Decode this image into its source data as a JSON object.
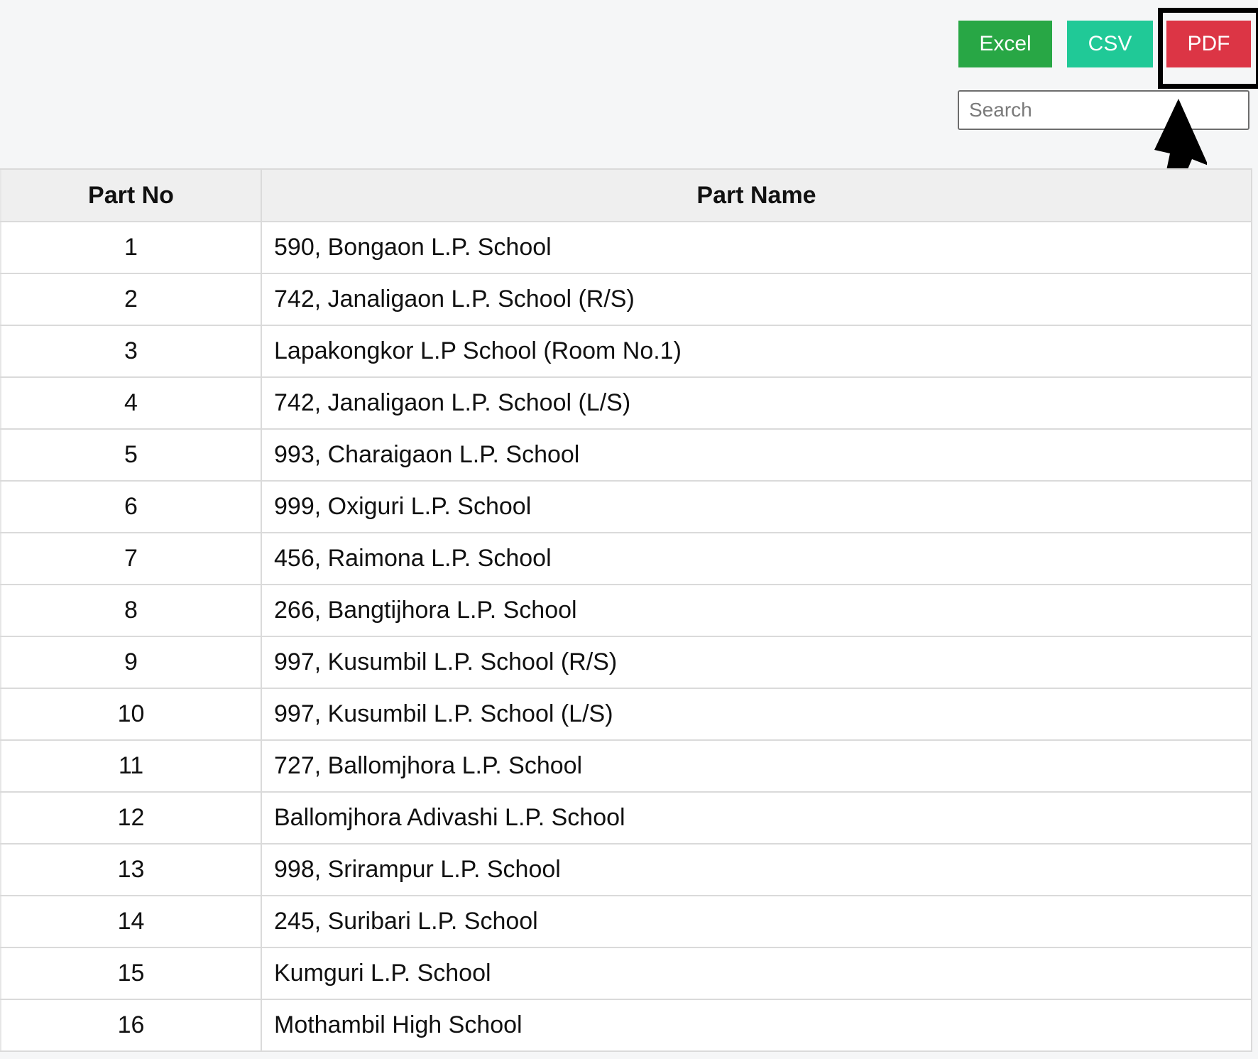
{
  "toolbar": {
    "excel_label": "Excel",
    "csv_label": "CSV",
    "pdf_label": "PDF"
  },
  "search": {
    "placeholder": "Search",
    "value": ""
  },
  "colors": {
    "excel": "#28a745",
    "csv": "#20c997",
    "pdf": "#dc3545"
  },
  "annotation": {
    "highlight_target": "pdf-button",
    "arrow_icon": "arrow-up-icon"
  },
  "table": {
    "columns": [
      "Part No",
      "Part Name"
    ],
    "rows": [
      [
        "1",
        "590, Bongaon L.P. School"
      ],
      [
        "2",
        "742, Janaligaon L.P. School (R/S)"
      ],
      [
        "3",
        "Lapakongkor L.P School (Room No.1)"
      ],
      [
        "4",
        "742, Janaligaon L.P. School (L/S)"
      ],
      [
        "5",
        "993, Charaigaon L.P. School"
      ],
      [
        "6",
        "999, Oxiguri L.P. School"
      ],
      [
        "7",
        "456, Raimona L.P. School"
      ],
      [
        "8",
        "266, Bangtijhora L.P. School"
      ],
      [
        "9",
        "997, Kusumbil L.P. School (R/S)"
      ],
      [
        "10",
        "997, Kusumbil L.P. School (L/S)"
      ],
      [
        "11",
        "727, Ballomjhora L.P. School"
      ],
      [
        "12",
        "Ballomjhora Adivashi L.P. School"
      ],
      [
        "13",
        "998, Srirampur L.P. School"
      ],
      [
        "14",
        "245, Suribari L.P. School"
      ],
      [
        "15",
        "Kumguri L.P. School"
      ],
      [
        "16",
        "Mothambil High School"
      ]
    ]
  }
}
